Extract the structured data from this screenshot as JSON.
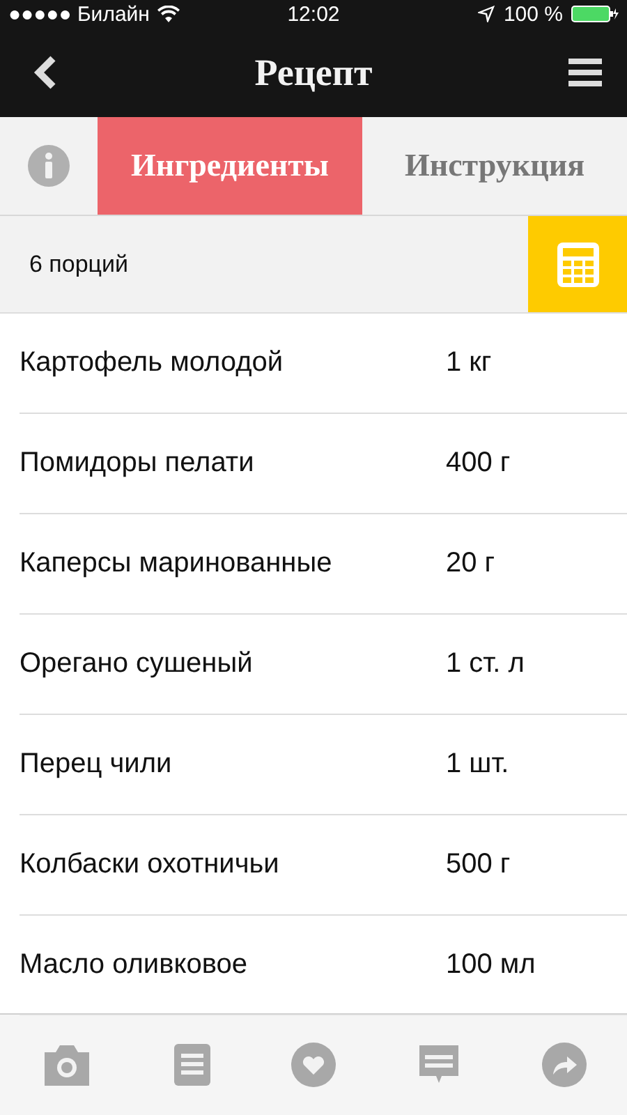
{
  "status_bar": {
    "carrier": "●●●●● Билайн",
    "time": "12:02",
    "battery": "100 %"
  },
  "nav": {
    "title": "Рецепт"
  },
  "tabs": [
    {
      "kind": "info",
      "selected": false
    },
    {
      "kind": "text",
      "label": "Ингредиенты",
      "selected": true
    },
    {
      "kind": "text",
      "label": "Инструкция",
      "selected": false
    }
  ],
  "servings": "6 порций",
  "ingredients": [
    {
      "name": "Картофель молодой",
      "amount": "1 кг"
    },
    {
      "name": "Помидоры пелати",
      "amount": "400 г"
    },
    {
      "name": "Каперсы маринованные",
      "amount": "20 г"
    },
    {
      "name": "Орегано сушеный",
      "amount": "1 ст. л"
    },
    {
      "name": "Перец чили",
      "amount": "1 шт."
    },
    {
      "name": "Колбаски охотничьи",
      "amount": "500 г"
    },
    {
      "name": "Масло оливковое",
      "amount": "100 мл"
    }
  ]
}
